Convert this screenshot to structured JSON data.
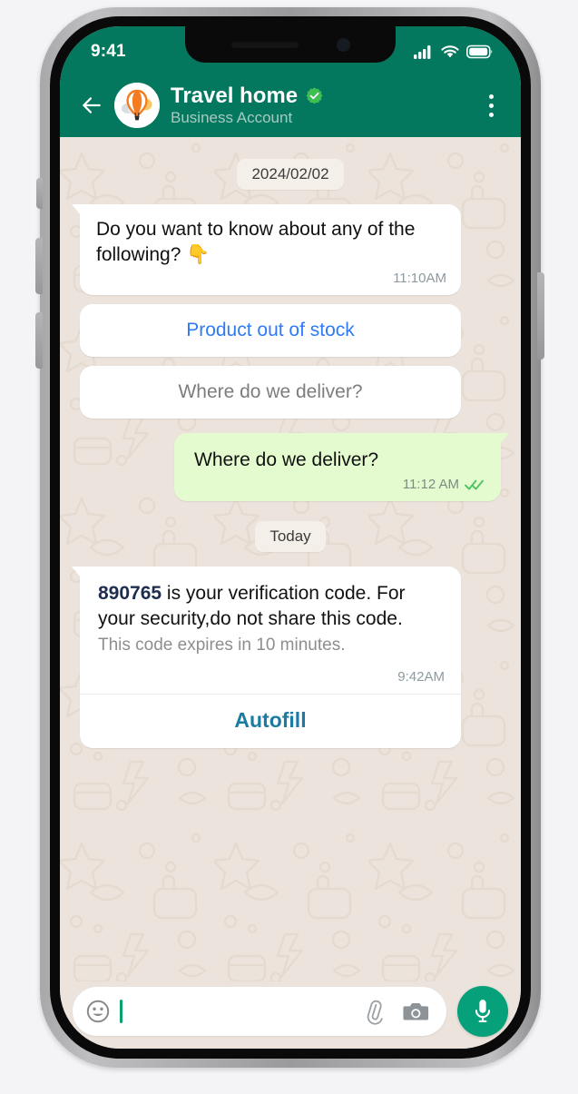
{
  "device": {
    "status_bar": {
      "time": "9:41",
      "icons": [
        "cellular-signal-icon",
        "wifi-icon",
        "battery-icon"
      ]
    }
  },
  "header": {
    "back_icon": "back-arrow-icon",
    "avatar_icon": "hot-air-balloon-avatar",
    "title": "Travel home",
    "verified_icon": "verified-badge-icon",
    "subtitle": "Business Account",
    "menu_icon": "overflow-menu-icon"
  },
  "chat": {
    "items": [
      {
        "kind": "date",
        "label": "2024/02/02"
      },
      {
        "kind": "incoming",
        "text": "Do you want to know about any of the following? 👇",
        "time": "11:10AM"
      },
      {
        "kind": "quick_reply",
        "label": "Product out of stock",
        "style": "blue"
      },
      {
        "kind": "quick_reply",
        "label": "Where do we deliver?",
        "style": "grey"
      },
      {
        "kind": "outgoing",
        "text": "Where do we deliver?",
        "time": "11:12 AM",
        "status_icon": "double-check-read-icon"
      },
      {
        "kind": "date",
        "label": "Today"
      },
      {
        "kind": "incoming_otp",
        "code": "890765",
        "text": " is your verification code. For your security,do not share this code.",
        "subtext": "This code expires in 10 minutes.",
        "time": "9:42AM",
        "action_label": "Autofill"
      }
    ]
  },
  "composer": {
    "emoji_icon": "emoji-smiley-icon",
    "input_value": "",
    "input_placeholder": "",
    "attach_icon": "paperclip-icon",
    "camera_icon": "camera-icon",
    "mic_icon": "microphone-icon"
  },
  "colors": {
    "header_green": "#03785f",
    "chat_bg": "#ece4dc",
    "outgoing_bubble": "#e4fbd0",
    "incoming_bubble": "#ffffff",
    "quick_reply_blue": "#2f7bf6",
    "autofill_teal": "#1b7ba0",
    "mic_green": "#06a07a",
    "read_check_green": "#4fc35f"
  }
}
